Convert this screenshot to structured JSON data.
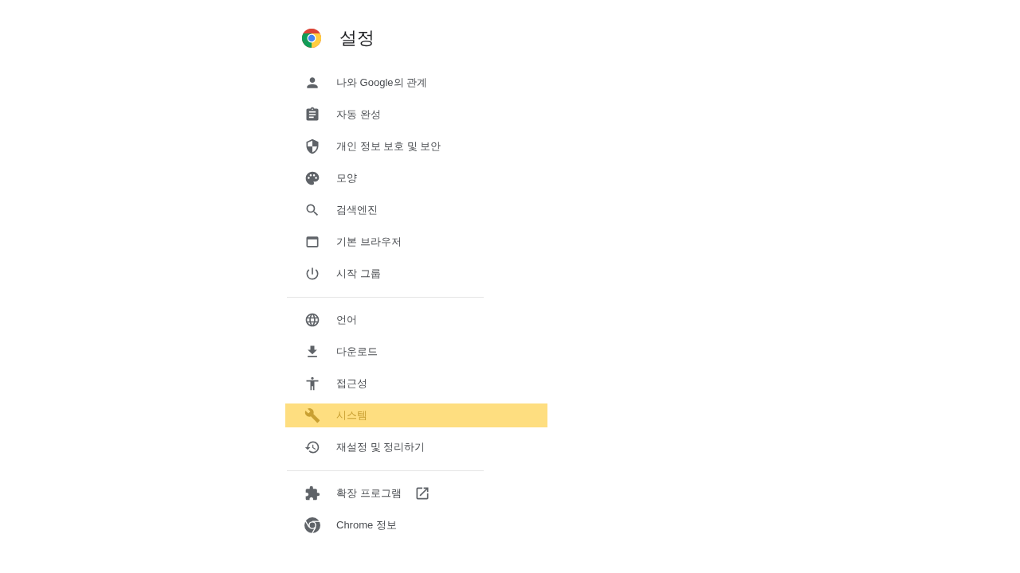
{
  "header": {
    "title": "설정"
  },
  "sections": [
    {
      "items": [
        {
          "label": "나와 Google의 관계",
          "selected": false,
          "external": false
        },
        {
          "label": "자동 완성",
          "selected": false,
          "external": false
        },
        {
          "label": "개인 정보 보호 및 보안",
          "selected": false,
          "external": false
        },
        {
          "label": "모양",
          "selected": false,
          "external": false
        },
        {
          "label": "검색엔진",
          "selected": false,
          "external": false
        },
        {
          "label": "기본 브라우저",
          "selected": false,
          "external": false
        },
        {
          "label": "시작 그룹",
          "selected": false,
          "external": false
        }
      ]
    },
    {
      "items": [
        {
          "label": "언어",
          "selected": false,
          "external": false
        },
        {
          "label": "다운로드",
          "selected": false,
          "external": false
        },
        {
          "label": "접근성",
          "selected": false,
          "external": false
        },
        {
          "label": "시스템",
          "selected": true,
          "external": false
        },
        {
          "label": "재설정 및 정리하기",
          "selected": false,
          "external": false
        }
      ]
    },
    {
      "items": [
        {
          "label": "확장 프로그램",
          "selected": false,
          "external": true
        },
        {
          "label": "Chrome 정보",
          "selected": false,
          "external": false
        }
      ]
    }
  ]
}
